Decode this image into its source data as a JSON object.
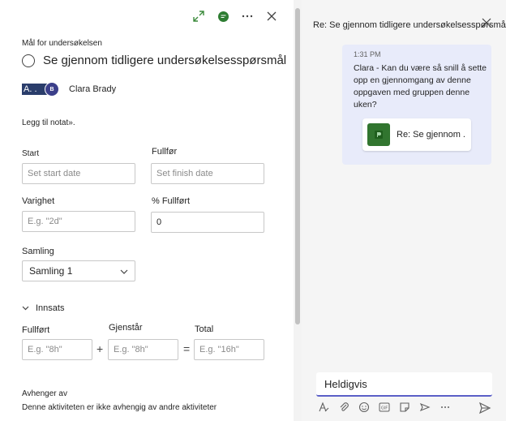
{
  "task": {
    "section_label": "Mål for undersøkelsen",
    "title": "Se gjennom tidligere undersøkelsesspørsmål",
    "assignee_chip_text": "A. .",
    "assignee_avatar_initials": "B",
    "assignee_name": "Clara Brady",
    "add_note": "Legg til notat»."
  },
  "dates": {
    "start_label": "Start",
    "start_placeholder": "Set start date",
    "finish_label": "Fullfør",
    "finish_placeholder": "Set finish date"
  },
  "duration": {
    "label": "Varighet",
    "placeholder": "E.g. \"2d\""
  },
  "percent": {
    "label": "% Fullført",
    "value": "0"
  },
  "bucket": {
    "label": "Samling",
    "value": "Samling 1"
  },
  "effort": {
    "section_label": "Innsats",
    "completed_label": "Fullført",
    "completed_placeholder": "E.g. \"8h\"",
    "remaining_label": "Gjenstår",
    "remaining_placeholder": "E.g. \"8h\"",
    "total_label": "Total",
    "total_placeholder": "E.g. \"16h\"",
    "plus": "+",
    "equals": "="
  },
  "dependencies": {
    "label": "Avhenger av",
    "text": "Denne aktiviteten er ikke avhengig av andre aktiviteter"
  },
  "chat": {
    "header": "Re: Se gjennom tidligere undersøkelsesspørsmål",
    "message_time": "1:31 PM",
    "message_text": "Clara - Kan du være så snill å sette opp en gjennomgang av denne oppgaven med gruppen denne uken?",
    "card_title": "Re: Se gjennom ."
  },
  "compose": {
    "value": "Heldigvis"
  },
  "colors": {
    "accent": "#5b5fc7",
    "expand_green": "#3d8b3d",
    "project_green": "#31752f"
  }
}
